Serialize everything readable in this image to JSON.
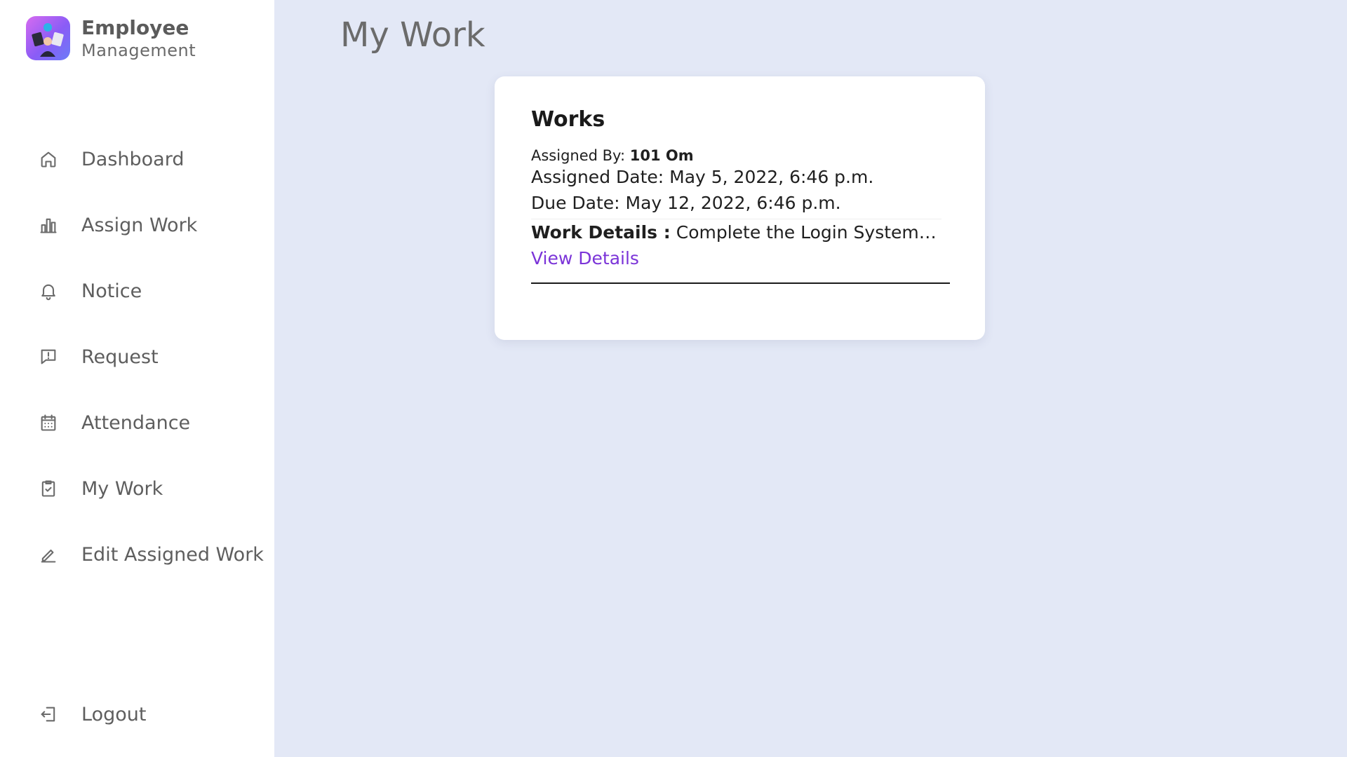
{
  "brand": {
    "title": "Employee",
    "subtitle": "Management"
  },
  "sidebar": {
    "items": [
      {
        "label": "Dashboard",
        "icon": "home-icon"
      },
      {
        "label": "Assign Work",
        "icon": "bar-chart-icon"
      },
      {
        "label": "Notice",
        "icon": "bell-icon"
      },
      {
        "label": "Request",
        "icon": "message-alert-icon"
      },
      {
        "label": "Attendance",
        "icon": "calendar-icon"
      },
      {
        "label": "My Work",
        "icon": "clipboard-check-icon"
      },
      {
        "label": "Edit Assigned Work",
        "icon": "pencil-icon"
      }
    ],
    "logout": {
      "label": "Logout",
      "icon": "logout-icon"
    }
  },
  "main": {
    "title": "My Work",
    "card": {
      "title": "Works",
      "assigned_by_label": "Assigned By:",
      "assigned_by_value": "101 Om",
      "assigned_date": "Assigned Date: May 5, 2022, 6:46 p.m.",
      "due_date": "Due Date: May 12, 2022, 6:46 p.m.",
      "work_details_label": "Work Details :",
      "work_details_value": "Complete the Login System Wit...",
      "view_details": "View Details"
    }
  },
  "colors": {
    "background": "#e3e8f6",
    "sidebar": "#ffffff",
    "link": "#7b34d8",
    "logo_gradient_start": "#d66bf0",
    "logo_gradient_end": "#6b7cf7"
  }
}
